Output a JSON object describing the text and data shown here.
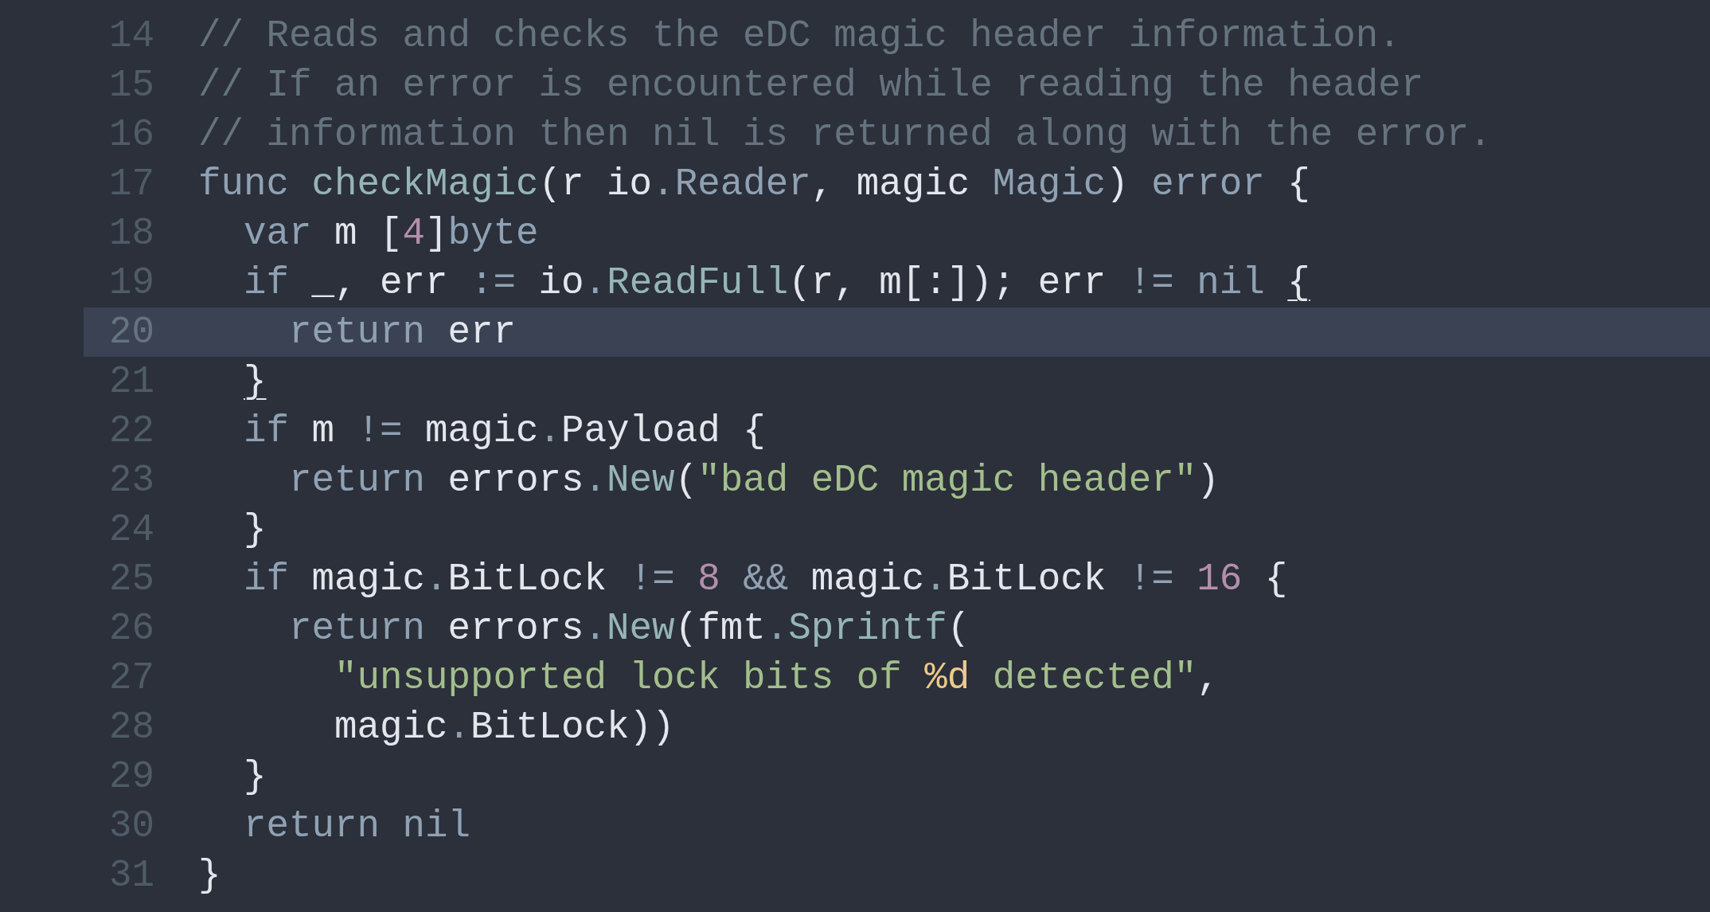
{
  "editor": {
    "lines": [
      {
        "number": "14",
        "current": false,
        "tokens": [
          {
            "kind": "comment",
            "text": "// Reads and checks the eDC magic header information."
          }
        ]
      },
      {
        "number": "15",
        "current": false,
        "tokens": [
          {
            "kind": "comment",
            "text": "// If an error is encountered while reading the header"
          }
        ]
      },
      {
        "number": "16",
        "current": false,
        "tokens": [
          {
            "kind": "comment",
            "text": "// information then nil is returned along with the error."
          }
        ]
      },
      {
        "number": "17",
        "current": false,
        "tokens": [
          {
            "kind": "keyword",
            "text": "func "
          },
          {
            "kind": "function",
            "text": "checkMagic"
          },
          {
            "kind": "plain",
            "text": "(r io"
          },
          {
            "kind": "operator",
            "text": "."
          },
          {
            "kind": "type",
            "text": "Reader"
          },
          {
            "kind": "plain",
            "text": ", magic "
          },
          {
            "kind": "type",
            "text": "Magic"
          },
          {
            "kind": "plain",
            "text": ") "
          },
          {
            "kind": "type",
            "text": "error"
          },
          {
            "kind": "plain",
            "text": " {"
          }
        ]
      },
      {
        "number": "18",
        "current": false,
        "tokens": [
          {
            "kind": "keyword",
            "text": "  var"
          },
          {
            "kind": "plain",
            "text": " m ["
          },
          {
            "kind": "number",
            "text": "4"
          },
          {
            "kind": "plain",
            "text": "]"
          },
          {
            "kind": "type",
            "text": "byte"
          }
        ]
      },
      {
        "number": "19",
        "current": false,
        "tokens": [
          {
            "kind": "keyword",
            "text": "  if"
          },
          {
            "kind": "plain",
            "text": " _, err "
          },
          {
            "kind": "operator",
            "text": ":="
          },
          {
            "kind": "plain",
            "text": " io"
          },
          {
            "kind": "operator",
            "text": "."
          },
          {
            "kind": "function",
            "text": "ReadFull"
          },
          {
            "kind": "plain",
            "text": "(r, m[:]); err "
          },
          {
            "kind": "operator",
            "text": "!= "
          },
          {
            "kind": "keyword",
            "text": "nil "
          },
          {
            "kind": "brace_match",
            "text": "{"
          }
        ]
      },
      {
        "number": "20",
        "current": true,
        "tokens": [
          {
            "kind": "keyword",
            "text": "    return"
          },
          {
            "kind": "plain",
            "text": " err"
          }
        ]
      },
      {
        "number": "21",
        "current": false,
        "tokens": [
          {
            "kind": "brace_match",
            "text": "  }"
          }
        ]
      },
      {
        "number": "22",
        "current": false,
        "tokens": [
          {
            "kind": "keyword",
            "text": "  if"
          },
          {
            "kind": "plain",
            "text": " m "
          },
          {
            "kind": "operator",
            "text": "!="
          },
          {
            "kind": "plain",
            "text": " magic"
          },
          {
            "kind": "operator",
            "text": "."
          },
          {
            "kind": "plain",
            "text": "Payload {"
          }
        ]
      },
      {
        "number": "23",
        "current": false,
        "tokens": [
          {
            "kind": "keyword",
            "text": "    return"
          },
          {
            "kind": "plain",
            "text": " errors"
          },
          {
            "kind": "operator",
            "text": "."
          },
          {
            "kind": "function",
            "text": "New"
          },
          {
            "kind": "plain",
            "text": "("
          },
          {
            "kind": "string",
            "text": "\"bad eDC magic header\""
          },
          {
            "kind": "plain",
            "text": ")"
          }
        ]
      },
      {
        "number": "24",
        "current": false,
        "tokens": [
          {
            "kind": "plain",
            "text": "  }"
          }
        ]
      },
      {
        "number": "25",
        "current": false,
        "tokens": [
          {
            "kind": "keyword",
            "text": "  if"
          },
          {
            "kind": "plain",
            "text": " magic"
          },
          {
            "kind": "operator",
            "text": "."
          },
          {
            "kind": "plain",
            "text": "BitLock "
          },
          {
            "kind": "operator",
            "text": "!= "
          },
          {
            "kind": "number",
            "text": "8 "
          },
          {
            "kind": "operator",
            "text": "&&"
          },
          {
            "kind": "plain",
            "text": " magic"
          },
          {
            "kind": "operator",
            "text": "."
          },
          {
            "kind": "plain",
            "text": "BitLock "
          },
          {
            "kind": "operator",
            "text": "!= "
          },
          {
            "kind": "number",
            "text": "16"
          },
          {
            "kind": "plain",
            "text": " {"
          }
        ]
      },
      {
        "number": "26",
        "current": false,
        "tokens": [
          {
            "kind": "keyword",
            "text": "    return"
          },
          {
            "kind": "plain",
            "text": " errors"
          },
          {
            "kind": "operator",
            "text": "."
          },
          {
            "kind": "function",
            "text": "New"
          },
          {
            "kind": "plain",
            "text": "(fmt"
          },
          {
            "kind": "operator",
            "text": "."
          },
          {
            "kind": "function",
            "text": "Sprintf"
          },
          {
            "kind": "plain",
            "text": "("
          }
        ]
      },
      {
        "number": "27",
        "current": false,
        "tokens": [
          {
            "kind": "string",
            "text": "      \"unsupported lock bits of "
          },
          {
            "kind": "format",
            "text": "%d"
          },
          {
            "kind": "string",
            "text": " detected\""
          },
          {
            "kind": "plain",
            "text": ","
          }
        ]
      },
      {
        "number": "28",
        "current": false,
        "tokens": [
          {
            "kind": "plain",
            "text": "      magic"
          },
          {
            "kind": "operator",
            "text": "."
          },
          {
            "kind": "plain",
            "text": "BitLock))"
          }
        ]
      },
      {
        "number": "29",
        "current": false,
        "tokens": [
          {
            "kind": "plain",
            "text": "  }"
          }
        ]
      },
      {
        "number": "30",
        "current": false,
        "tokens": [
          {
            "kind": "keyword",
            "text": "  return nil"
          }
        ]
      },
      {
        "number": "31",
        "current": false,
        "tokens": [
          {
            "kind": "plain",
            "text": "}"
          }
        ]
      }
    ]
  }
}
